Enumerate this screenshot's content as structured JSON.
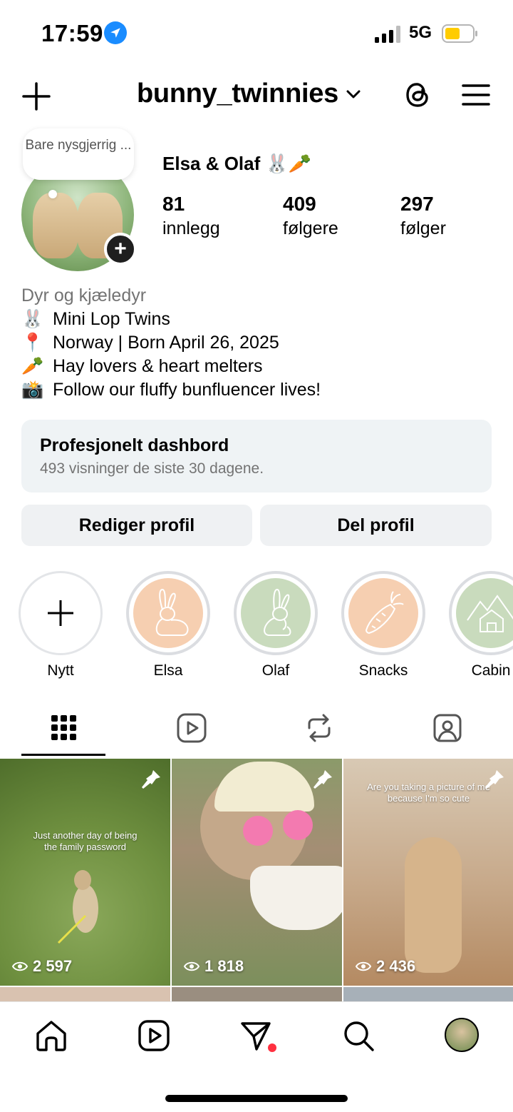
{
  "status": {
    "time": "17:59",
    "network": "5G"
  },
  "header": {
    "username": "bunny_twinnies"
  },
  "profile": {
    "note": "Bare nysgjerrig ...",
    "display_name": "Elsa & Olaf 🐰🥕",
    "stats": [
      {
        "value": "81",
        "label": "innlegg"
      },
      {
        "value": "409",
        "label": "følgere"
      },
      {
        "value": "297",
        "label": "følger"
      }
    ],
    "bio": {
      "category": "Dyr og kjæledyr",
      "lines": [
        {
          "emoji": "🐰",
          "text": "Mini Lop Twins"
        },
        {
          "emoji": "📍",
          "text": "Norway | Born April 26, 2025"
        },
        {
          "emoji": "🥕",
          "text": "Hay lovers & heart melters"
        },
        {
          "emoji": "📸",
          "text": "Follow our fluffy bunfluencer lives!"
        }
      ]
    }
  },
  "dashboard": {
    "title": "Profesjonelt dashbord",
    "subtitle": "493 visninger de siste 30 dagene."
  },
  "buttons": {
    "edit": "Rediger profil",
    "share": "Del profil"
  },
  "highlights": [
    {
      "label": "Nytt",
      "icon": "plus-icon"
    },
    {
      "label": "Elsa",
      "icon": "rabbit-icon",
      "color": "#f6cfb1"
    },
    {
      "label": "Olaf",
      "icon": "rabbit-icon",
      "color": "#c9dbbd"
    },
    {
      "label": "Snacks",
      "icon": "carrot-icon",
      "color": "#f6cfb1"
    },
    {
      "label": "Cabin",
      "icon": "house-icon",
      "color": "#c9dbbd"
    }
  ],
  "posts": [
    {
      "caption": "Just another day of being the family password",
      "views": "2 597"
    },
    {
      "caption": "",
      "views": "1 818"
    },
    {
      "caption": "Are you taking a picture of me because I'm so cute",
      "views": "2 436"
    }
  ],
  "colors": {
    "accent": "#1a8cff",
    "notification": "#ff3040",
    "battery": "#ffcc00"
  }
}
